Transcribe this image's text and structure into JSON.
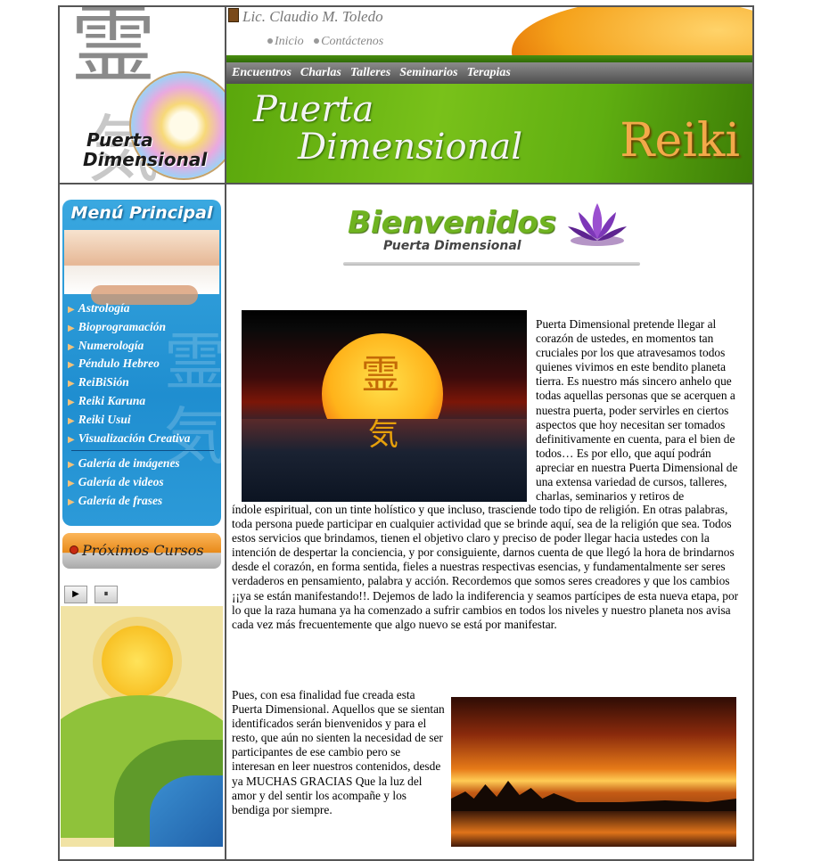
{
  "logo": {
    "kanji_top": "霊",
    "kanji_bottom": "気",
    "line1": "Puerta",
    "line2": "Dimensional"
  },
  "header": {
    "owner": "Lic. Claudio M. Toledo",
    "top_links": [
      "Inicio",
      "Contáctenos"
    ],
    "nav": [
      "Encuentros",
      "Charlas",
      "Talleres",
      "Seminarios",
      "Terapias"
    ],
    "banner_line1": "Puerta",
    "banner_line2": "Dimensional",
    "banner_reiki": "Reiki"
  },
  "sidebar": {
    "menu_title": "Menú Principal",
    "menu_items": [
      "Astrología",
      "Bioprogramación",
      "Numerología",
      "Péndulo Hebreo",
      "ReiBiSión",
      "Reiki Karuna",
      "Reiki Usui",
      "Visualización Creativa"
    ],
    "gallery_items": [
      "Galería de imágenes",
      "Galería de videos",
      "Galería de frases"
    ],
    "courses": "Próximos Cursos",
    "player": {
      "play": "▶",
      "pause": "⏸"
    }
  },
  "main": {
    "welcome_title": "Bienvenidos",
    "welcome_subtitle": "Puerta Dimensional",
    "image1_kanji_top": "霊",
    "image1_kanji_bottom": "気",
    "paragraph_right": "Puerta Dimensional pretende llegar al corazón de ustedes, en momentos tan cruciales por los que atravesamos todos quienes vivimos en este bendito planeta tierra. Es nuestro más sincero anhelo que todas aquellas personas que se acerquen a nuestra puerta, poder servirles en ciertos aspectos que hoy necesitan ser tomados definitivamente en cuenta, para el bien de todos… Es por ello, que aquí podrán apreciar en nuestra Puerta Dimensional de una extensa variedad de cursos, talleres, charlas, seminarios y retiros de",
    "paragraph_full": "índole espiritual, con un tinte holístico y que incluso, trasciende todo tipo de religión. En otras palabras, toda persona puede participar en cualquier actividad que se brinde aquí, sea de la religión que sea. Todos estos servicios que brindamos, tienen el objetivo claro y preciso de poder llegar hacia ustedes con la intención de despertar la conciencia, y por consiguiente, darnos cuenta de que llegó la hora de brindarnos desde el corazón, en forma sentida, fieles a nuestras respectivas esencias, y fundamentalmente ser seres verdaderos en pensamiento, palabra y acción. Recordemos que somos seres creadores y que los cambios ¡¡ya se están manifestando!!. Dejemos de lado la indiferencia y seamos partícipes de esta nueva etapa, por lo que la raza humana ya ha comenzado a sufrir cambios en todos los niveles y nuestro planeta nos avisa cada vez más frecuentemente que algo nuevo se está por manifestar.",
    "paragraph_left": "Pues, con esa finalidad fue creada esta Puerta Dimensional. Aquellos que se sientan identificados serán bienvenidos y para el resto, que aún no sienten la necesidad de ser participantes de ese cambio pero se interesan en leer nuestros contenidos, desde ya MUCHAS GRACIAS Que la luz del amor y del sentir los acompañe y los bendiga por siempre."
  }
}
